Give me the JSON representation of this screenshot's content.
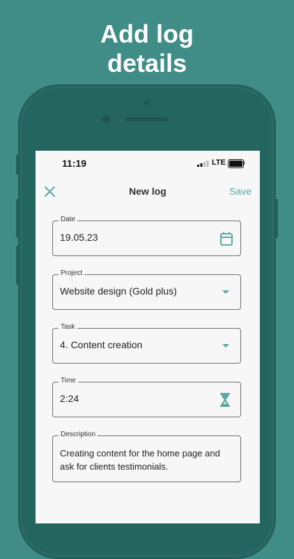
{
  "headline": {
    "line1": "Add log",
    "line2": "details"
  },
  "status_bar": {
    "time": "11:19",
    "network": "LTE"
  },
  "app_bar": {
    "title": "New log",
    "save_label": "Save",
    "close_icon": "close-icon"
  },
  "form": {
    "date": {
      "label": "Date",
      "value": "19.05.23",
      "icon": "calendar-icon"
    },
    "project": {
      "label": "Project",
      "value": "Website design (Gold plus)",
      "icon": "dropdown-arrow-icon"
    },
    "task": {
      "label": "Task",
      "value": "4. Content creation",
      "icon": "dropdown-arrow-icon"
    },
    "time": {
      "label": "Time",
      "value": "2:24",
      "icon": "hourglass-icon"
    },
    "description": {
      "label": "Description",
      "value": "Creating content for the home page and ask for clients testimonials."
    }
  },
  "colors": {
    "background": "#3f8d86",
    "accent": "#5aa9a2",
    "phone": "#2b6b66",
    "screen": "#f7f7f7"
  }
}
